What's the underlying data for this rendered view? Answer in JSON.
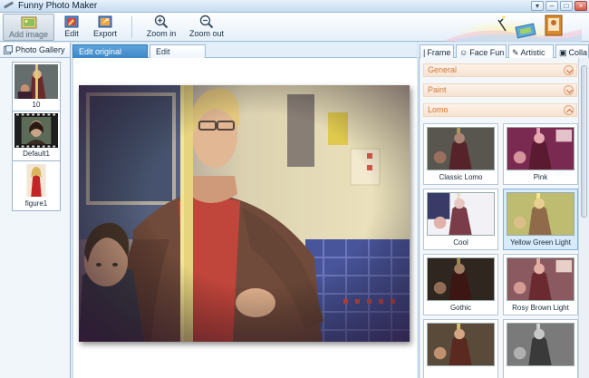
{
  "window": {
    "title": "Funny Photo Maker"
  },
  "toolbar": {
    "add_image": "Add image",
    "edit": "Edit",
    "export": "Export",
    "zoom_in": "Zoom in",
    "zoom_out": "Zoom out"
  },
  "gallery": {
    "title": "Photo Gallery",
    "items": [
      {
        "label": "10"
      },
      {
        "label": "Default1"
      },
      {
        "label": "figure1"
      }
    ]
  },
  "editor": {
    "tabs": [
      {
        "label": "Edit original image"
      },
      {
        "label": "Edit template"
      }
    ]
  },
  "right_panel": {
    "tabs": [
      {
        "label": "Frame"
      },
      {
        "label": "Face Fun"
      },
      {
        "label": "Artistic"
      },
      {
        "label": "Colla"
      }
    ],
    "sections": [
      {
        "label": "General"
      },
      {
        "label": "Paint"
      },
      {
        "label": "Lomo"
      }
    ],
    "filters": [
      {
        "label": "Classic Lomo"
      },
      {
        "label": "Pink"
      },
      {
        "label": "Cool"
      },
      {
        "label": "Yellow Green Light"
      },
      {
        "label": "Gothic"
      },
      {
        "label": "Rosy Brown Light"
      }
    ]
  }
}
